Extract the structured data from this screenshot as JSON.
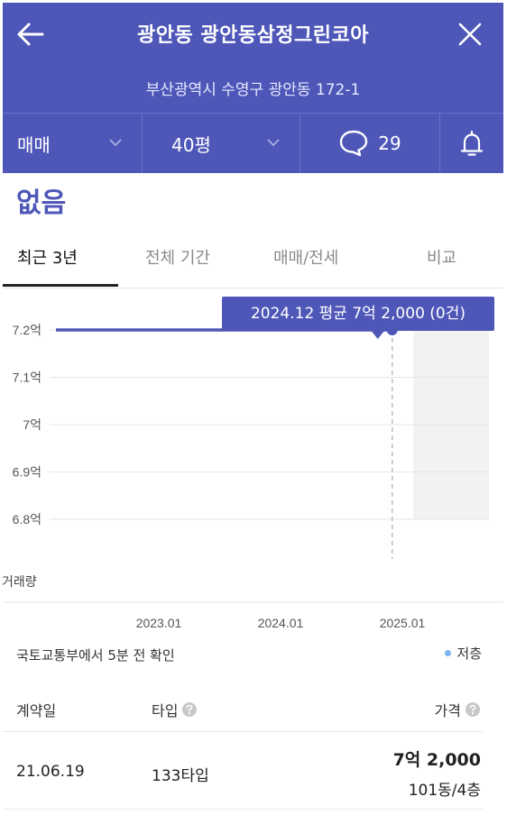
{
  "header": {
    "title": "광안동 광안동삼정그린코아",
    "address": "부산광역시 수영구 광안동 172-1"
  },
  "filters": {
    "trade_type": "매매",
    "size": "40평",
    "comment_count": "29"
  },
  "no_data_text": "없음",
  "tabs": [
    {
      "label": "최근 3년",
      "active": true
    },
    {
      "label": "전체 기간",
      "active": false
    },
    {
      "label": "매매/전세",
      "active": false
    },
    {
      "label": "비교",
      "active": false
    }
  ],
  "chart_data": {
    "type": "line",
    "y_ticks": [
      "7.2억",
      "7.1억",
      "7억",
      "6.9억",
      "6.8억"
    ],
    "ylim": [
      6.8,
      7.2
    ],
    "x_ticks": [
      "2023.01",
      "2024.01",
      "2025.01"
    ],
    "volume_label": "거래량",
    "series": [
      {
        "x": [
          "2022.01",
          "2024.12"
        ],
        "values": [
          7.2,
          7.2
        ]
      }
    ],
    "tooltip": "2024.12 평균 7억 2,000 (0건)"
  },
  "source_text": "국토교통부에서 5분 전 확인",
  "legend_label": "저층",
  "colors": {
    "brand": "#4e57b8",
    "legend_dot": "#7fb4f0"
  },
  "table": {
    "headers": {
      "date": "계약일",
      "type": "타입",
      "price": "가격"
    },
    "rows": [
      {
        "date": "21.06.19",
        "type": "133타입",
        "price": "7억 2,000",
        "unit": "101동/4층"
      }
    ]
  }
}
